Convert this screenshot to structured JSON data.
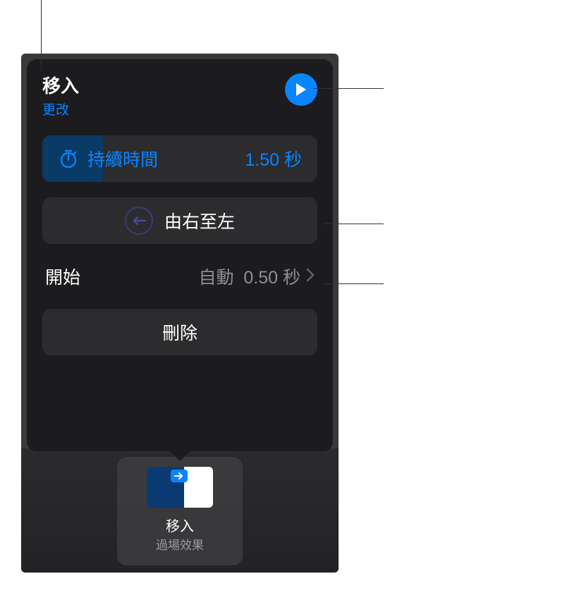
{
  "popover": {
    "title": "移入",
    "change_link": "更改",
    "duration": {
      "label": "持續時間",
      "value": "1.50 秒"
    },
    "direction": {
      "label": "由右至左"
    },
    "start": {
      "label": "開始",
      "mode": "自動",
      "delay": "0.50 秒"
    },
    "delete_label": "刪除"
  },
  "thumb": {
    "title": "移入",
    "subtitle": "過場效果"
  }
}
